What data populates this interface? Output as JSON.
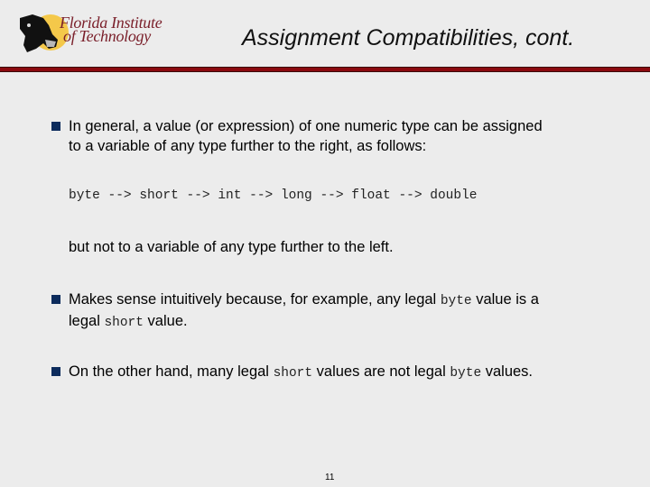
{
  "logo": {
    "line1": "Florida Institute",
    "line2": "of Technology",
    "brand_color": "#7a1f2a"
  },
  "title": "Assignment Compatibilities, cont.",
  "accent_color": "#8b0a0f",
  "bullet_color": "#0c2b5c",
  "bullets": [
    {
      "line1": "In general, a value (or expression) of one numeric type can be assigned",
      "line2": "to a variable of any type further to the right, as follows:"
    }
  ],
  "code_line": "byte --> short --> int --> long --> float --> double",
  "continuation": "but not to a variable of any type further to the left.",
  "bullet2": {
    "part1": "Makes sense intuitively because, for example, any legal ",
    "code1": "byte",
    "part2": " value is a",
    "part3": "legal ",
    "code2": "short",
    "part4": " value."
  },
  "bullet3": {
    "part1": "On the other hand, many legal ",
    "code1": "short",
    "part2": " values are not legal ",
    "code2": "byte",
    "part3": " values."
  },
  "page_number": "11"
}
